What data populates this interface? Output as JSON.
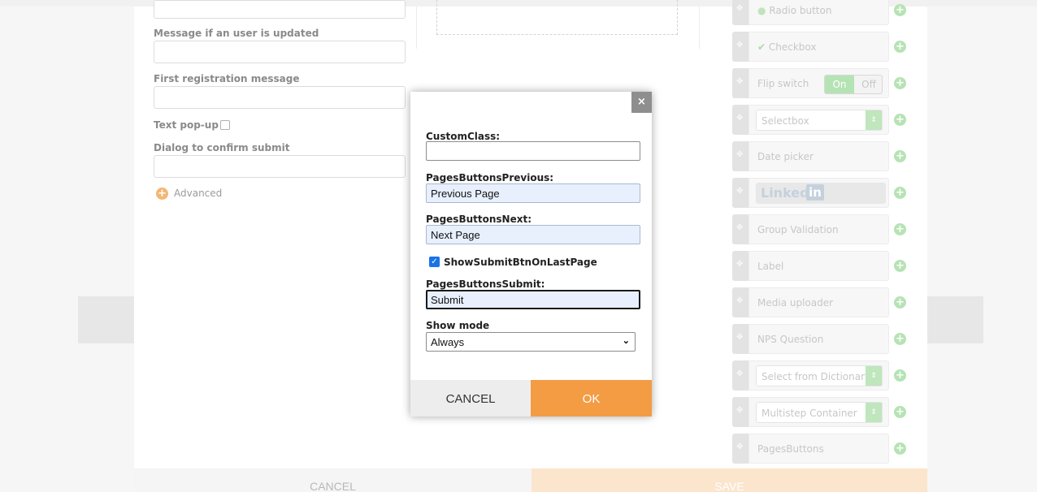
{
  "form_settings": {
    "message_updated_label": "Message if an user is updated",
    "first_registration_label": "First registration message",
    "text_popup_label": "Text pop-up",
    "dialog_confirm_label": "Dialog to confirm submit",
    "advanced_label": "Advanced"
  },
  "palette": {
    "radio_button": "Radio button",
    "checkbox": "Checkbox",
    "flip_switch": "Flip switch",
    "flip_on": "On",
    "flip_off": "Off",
    "selectbox": "Selectbox",
    "date_picker": "Date picker",
    "linkedin_text": "Linked",
    "linkedin_in": "in",
    "group_validation": "Group Validation",
    "label": "Label",
    "media_uploader": "Media uploader",
    "nps_question": "NPS Question",
    "select_from_dictionary": "Select from Dictionary",
    "multistep_container": "Multistep Container",
    "pages_buttons": "PagesButtons"
  },
  "footer": {
    "cancel_label": "CANCEL",
    "save_label": "SAVE"
  },
  "modal": {
    "close_label": "×",
    "custom_class_label": "CustomClass:",
    "custom_class_value": "",
    "prev_label": "PagesButtonsPrevious:",
    "prev_value": "Previous Page",
    "next_label": "PagesButtonsNext:",
    "next_value": "Next Page",
    "show_submit_label": "ShowSubmitBtnOnLastPage",
    "show_submit_checked": true,
    "submit_label": "PagesButtonsSubmit:",
    "submit_value": "Submit",
    "show_mode_label": "Show mode",
    "show_mode_value": "Always",
    "cancel_label": "CANCEL",
    "ok_label": "OK"
  },
  "colors": {
    "accent_orange": "#f39c43",
    "add_green": "#b6e3b4",
    "checkbox_blue": "#1a73e8"
  }
}
